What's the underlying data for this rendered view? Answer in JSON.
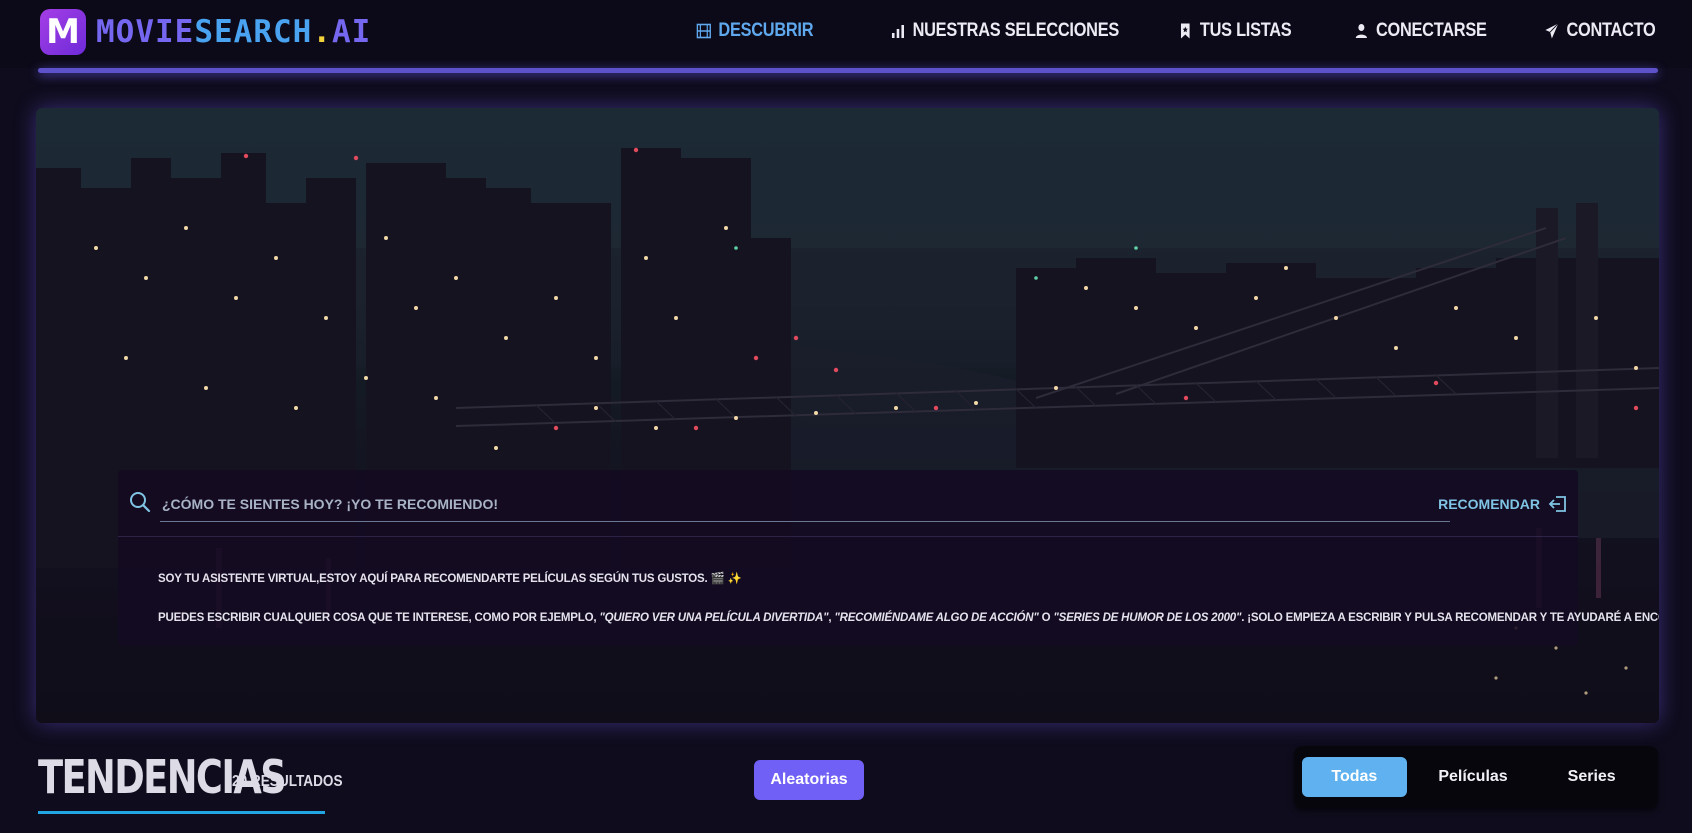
{
  "logo": {
    "badge": "M",
    "part1": "MOVIE",
    "part2": "SEARCH",
    "dot": ".",
    "part3": "AI"
  },
  "nav": {
    "items": [
      {
        "label": "DESCUBRIR",
        "icon": "film-icon",
        "active": true
      },
      {
        "label": "NUESTRAS SELECCIONES",
        "icon": "bar-chart-icon",
        "active": false
      },
      {
        "label": "TUS LISTAS",
        "icon": "bookmark-icon",
        "active": false
      },
      {
        "label": "CONECTARSE",
        "icon": "user-icon",
        "active": false
      },
      {
        "label": "CONTACTO",
        "icon": "paper-plane-icon",
        "active": false
      }
    ]
  },
  "assistant": {
    "search_placeholder": "¿CÓMO TE SIENTES HOY? ¡YO TE RECOMIENDO!",
    "search_value": "",
    "recommend_label": "RECOMENDAR",
    "message1": "SOY TU ASISTENTE VIRTUAL,ESTOY AQUÍ PARA RECOMENDARTE PELÍCULAS SEGÚN TUS GUSTOS. 🎬 ✨",
    "message2_intro": "PUEDES ESCRIBIR CUALQUIER COSA QUE TE INTERESE, COMO POR EJEMPLO, ",
    "example1": "\"QUIERO VER UNA PELÍCULA DIVERTIDA\"",
    "sep1": ", ",
    "example2": "\"RECOMIÉNDAME ALGO DE ACCIÓN\"",
    "sep2": " O ",
    "example3": "\"SERIES DE HUMOR DE LOS 2000\"",
    "message2_outro": ". ¡SOLO EMPIEZA A ESCRIBIR Y PULSA RECOMENDAR Y TE AYUDARÉ A ENCONTRAR LO QUE BUSCAS! 😊"
  },
  "trends": {
    "title": "TENDENCIAS",
    "count": "20 RESULTADOS",
    "random_label": "Aleatorias",
    "filters": [
      {
        "label": "Todas",
        "active": true
      },
      {
        "label": "Películas",
        "active": false
      },
      {
        "label": "Series",
        "active": false
      }
    ]
  },
  "colors": {
    "accent": "#7160f5",
    "nav_active": "#5fa8ee",
    "filter_active": "#5fb2ef",
    "underline": "#22a6e3"
  }
}
